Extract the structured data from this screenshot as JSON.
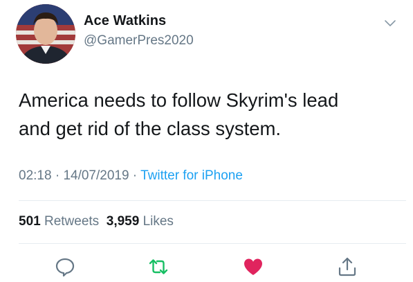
{
  "author": {
    "name": "Ace Watkins",
    "handle": "@GamerPres2020"
  },
  "tweet": {
    "text_line1": "America needs to follow Skyrim's lead",
    "text_line2": "and get rid of the class system."
  },
  "meta": {
    "time": "02:18",
    "sep1": " · ",
    "date": "14/07/2019",
    "sep2": " · ",
    "source": "Twitter for iPhone"
  },
  "stats": {
    "retweets_count": "501",
    "retweets_label": "Retweets",
    "likes_count": "3,959",
    "likes_label": "Likes"
  },
  "icons": {
    "more": "chevron-down-icon",
    "reply": "reply-icon",
    "retweet": "retweet-icon",
    "like": "heart-icon",
    "share": "share-icon"
  },
  "colors": {
    "text": "#14171a",
    "secondary": "#657786",
    "link": "#1da1f2",
    "retweet": "#17bf63",
    "like": "#e0245e"
  }
}
